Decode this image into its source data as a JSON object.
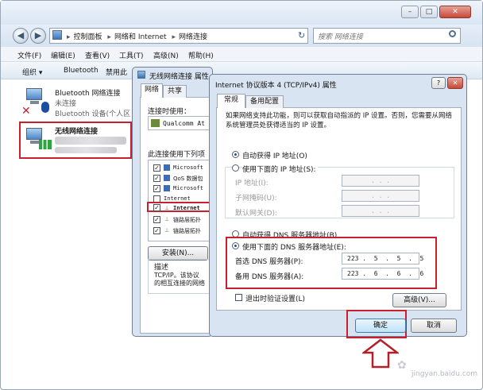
{
  "window": {
    "close_glyph": "✕",
    "max_glyph": "□",
    "min_glyph": "–"
  },
  "nav": {
    "back_glyph": "◀",
    "forward_glyph": "▶",
    "refresh_glyph": "↻",
    "breadcrumb": [
      "控制面板",
      "网络和 Internet",
      "网络连接"
    ],
    "breadcrumb_sep": "▸"
  },
  "search": {
    "placeholder": "搜索 网络连接"
  },
  "menu": [
    "文件(F)",
    "编辑(E)",
    "查看(V)",
    "工具(T)",
    "高级(N)",
    "帮助(H)"
  ],
  "commands": [
    "组织 ▾",
    "Bluetooth",
    "禁用此"
  ],
  "connections": [
    {
      "name": "Bluetooth 网络连接",
      "status": "未连接",
      "device": "Bluetooth 设备(个人区"
    },
    {
      "name": "无线网络连接",
      "status": "",
      "device": ""
    }
  ],
  "props_dialog": {
    "title": "无线网络连接 属性",
    "tabs": [
      "网络",
      "共享"
    ],
    "connect_using_label": "连接时使用：",
    "adapter": "Qualcomm At",
    "items_label": "此连接使用下列项",
    "items": [
      "Microsoft",
      "QoS 数据包",
      "Microsoft",
      "Internet",
      "Internet",
      "链路层拓扑",
      "链路层拓扑"
    ],
    "install_button": "安装(N)...",
    "description_label": "描述",
    "description_text": "TCP/IP。该协议\n的相互连接的网络"
  },
  "ipv4_dialog": {
    "title": "Internet 协议版本 4 (TCP/IPv4) 属性",
    "help_glyph": "?",
    "close_glyph": "✕",
    "tabs": [
      "常规",
      "备用配置"
    ],
    "intro": "如果网络支持此功能，则可以获取自动指派的 IP 设置。否则，您需要从网络系统管理员处获得适当的 IP 设置。",
    "auto_ip": "自动获得 IP 地址(O)",
    "manual_ip": "使用下面的 IP 地址(S):",
    "ip_label": "IP 地址(I):",
    "mask_label": "子网掩码(U):",
    "gateway_label": "默认网关(D):",
    "empty_ip": ".     .     .",
    "auto_dns": "自动获得 DNS 服务器地址(B)",
    "manual_dns": "使用下面的 DNS 服务器地址(E):",
    "preferred_dns_label": "首选 DNS 服务器(P):",
    "preferred_dns_value": "223 .  5  .  5  .  5",
    "alternate_dns_label": "备用 DNS 服务器(A):",
    "alternate_dns_value": "223 .  6  .  6  .  6",
    "validate_label": "退出时验证设置(L)",
    "advanced_button": "高级(V)...",
    "ok_button": "确定",
    "cancel_button": "取消"
  },
  "watermark": {
    "text": "jingyan.baidu.com"
  },
  "colors": {
    "highlight_red": "#c8202f",
    "arrow_red": "#b3202a"
  }
}
